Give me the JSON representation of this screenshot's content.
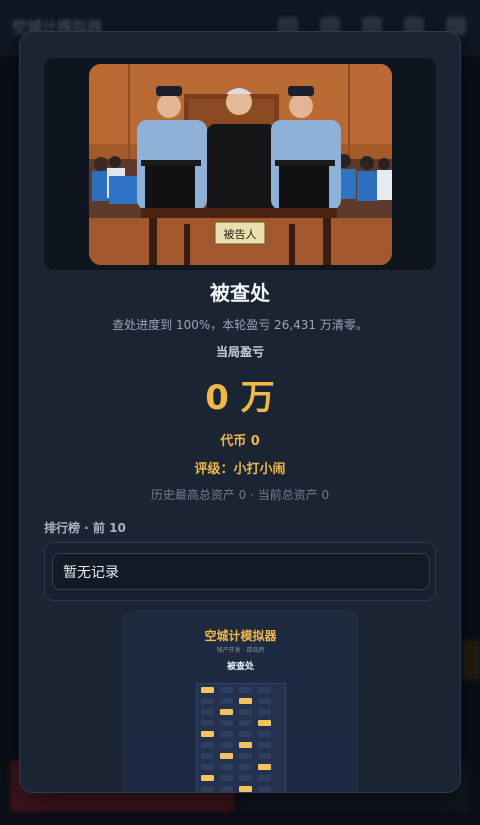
{
  "background": {
    "app_title": "空城计模拟器"
  },
  "modal": {
    "photo": {
      "placard_text": "被告人"
    },
    "title": "被查处",
    "description": "查处进度到 100%，本轮盈亏 26,431 万清零。",
    "loss_label": "当局盈亏",
    "loss_value": "0 万",
    "coins": "代币 0",
    "rating": "评级：小打小闹",
    "assets": "历史最高总资产 0 · 当前总资产 0",
    "leaderboard": {
      "title": "排行榜 · 前 10",
      "empty_text": "暂无记录"
    },
    "poster": {
      "title": "空城计模拟器",
      "subtitle": "钱产开发 · 孤岛跨",
      "tag": "被查处"
    }
  },
  "colors": {
    "accent_gold": "#f0b84a",
    "modal_bg": "#1b2433"
  }
}
